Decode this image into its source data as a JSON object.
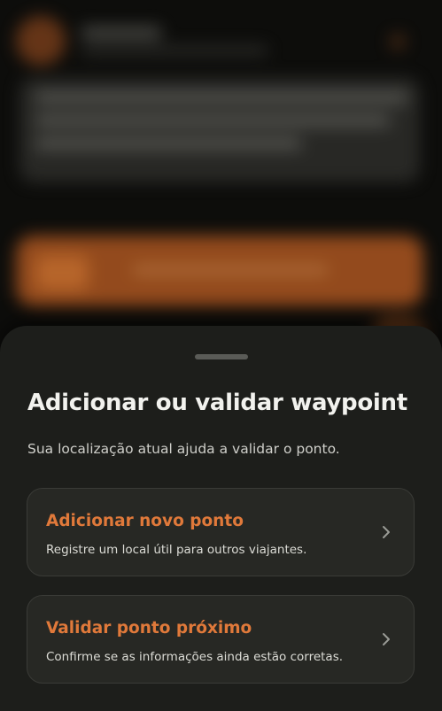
{
  "sheet": {
    "title": "Adicionar ou validar waypoint",
    "subtitle": "Sua localização atual ajuda a validar o ponto.",
    "options": [
      {
        "title": "Adicionar novo ponto",
        "description": "Registre um local útil para outros viajantes.",
        "icon": "chevron-right-icon"
      },
      {
        "title": "Validar ponto próximo",
        "description": "Confirme se as informações ainda estão corretas.",
        "icon": "chevron-right-icon"
      }
    ]
  },
  "colors": {
    "accent": "#e0793a",
    "sheet_background": "#1d1e1b",
    "card_background": "#272824",
    "title_text": "#f2f2ee"
  }
}
